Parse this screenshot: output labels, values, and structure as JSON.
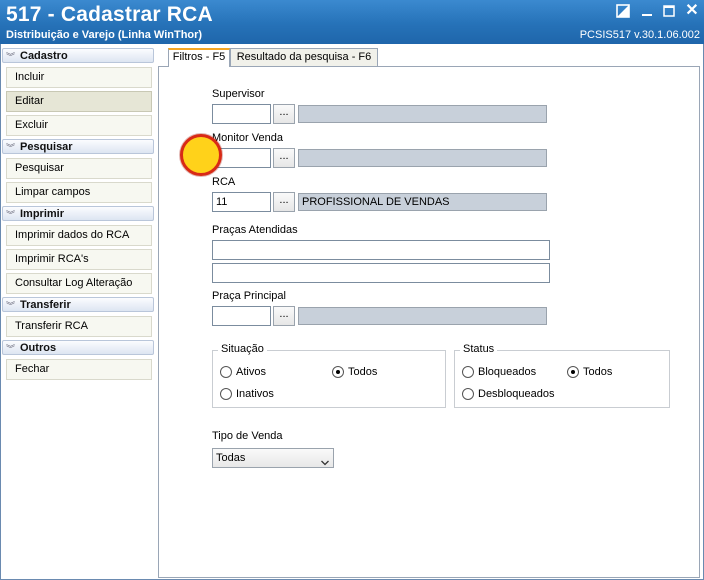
{
  "window": {
    "title": "517 - Cadastrar RCA",
    "subtitle": "Distribuição e Varejo (Linha WinThor)",
    "version": "PCSIS517  v.30.1.06.002"
  },
  "sidebar": {
    "sections": [
      {
        "label": "Cadastro",
        "items": [
          "Incluir",
          "Editar",
          "Excluir"
        ]
      },
      {
        "label": "Pesquisar",
        "items": [
          "Pesquisar",
          "Limpar campos"
        ]
      },
      {
        "label": "Imprimir",
        "items": [
          "Imprimir dados do RCA",
          "Imprimir RCA's",
          "Consultar Log Alteração"
        ]
      },
      {
        "label": "Transferir",
        "items": [
          "Transferir RCA"
        ]
      },
      {
        "label": "Outros",
        "items": [
          "Fechar"
        ]
      }
    ]
  },
  "tabs": [
    {
      "label": "Filtros - F5",
      "selected": true
    },
    {
      "label": "Resultado da pesquisa - F6",
      "selected": false
    }
  ],
  "filters": {
    "dots_label": "...",
    "supervisor": {
      "label": "Supervisor",
      "code": "",
      "description": ""
    },
    "monitor_venda": {
      "label": "Monitor Venda",
      "code": "",
      "description": ""
    },
    "rca": {
      "label": "RCA",
      "code": "11",
      "description": "PROFISSIONAL DE VENDAS"
    },
    "pracas_atendidas": {
      "label": "Praças Atendidas",
      "line1": "",
      "line2": ""
    },
    "praca_principal": {
      "label": "Praça Principal",
      "code": "",
      "description": ""
    },
    "situacao": {
      "title": "Situação",
      "options": [
        {
          "label": "Ativos",
          "checked": false
        },
        {
          "label": "Todos",
          "checked": true
        },
        {
          "label": "Inativos",
          "checked": false
        }
      ]
    },
    "status": {
      "title": "Status",
      "options": [
        {
          "label": "Bloqueados",
          "checked": false
        },
        {
          "label": "Todos",
          "checked": true
        },
        {
          "label": "Desbloqueados",
          "checked": false
        }
      ]
    },
    "tipo_venda": {
      "label": "Tipo de Venda",
      "selected": "Todas"
    }
  },
  "colors": {
    "titlebar": "#2672b8",
    "tab_accent": "#f5a623",
    "cursor_fill": "#ffd21a",
    "cursor_ring": "#d82a16"
  }
}
